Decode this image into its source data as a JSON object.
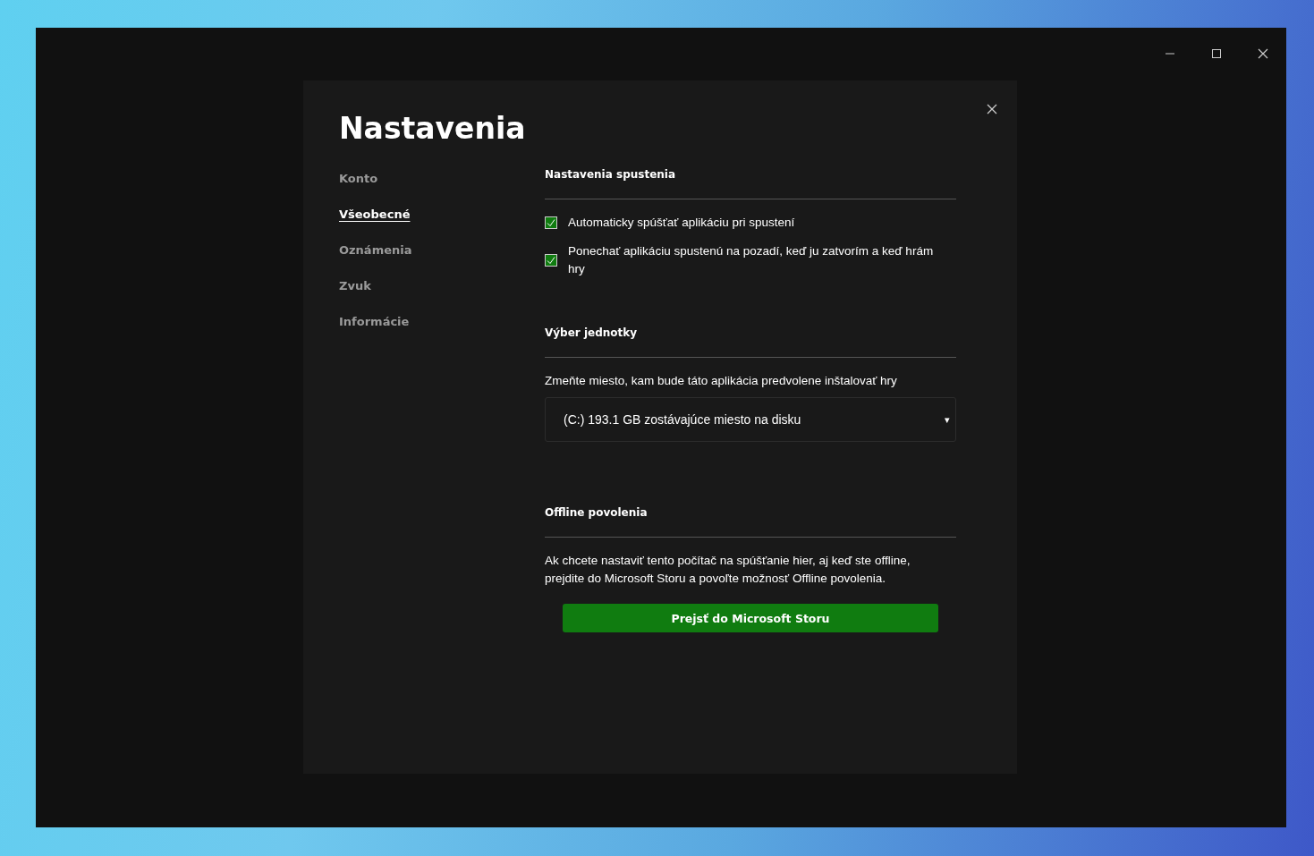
{
  "dialog": {
    "title": "Nastavenia"
  },
  "sidebar": {
    "items": [
      {
        "label": "Konto",
        "selected": false
      },
      {
        "label": "Všeobecné",
        "selected": true
      },
      {
        "label": "Oznámenia",
        "selected": false
      },
      {
        "label": "Zvuk",
        "selected": false
      },
      {
        "label": "Informácie",
        "selected": false
      }
    ]
  },
  "sections": [
    {
      "kind": "checkboxes",
      "heading": "Nastavenia spustenia",
      "options": [
        {
          "label": "Automaticky spúšťať aplikáciu pri spustení",
          "checked": true
        },
        {
          "label": "Ponechať aplikáciu spustenú na pozadí, keď ju zatvorím a keď hrám hry",
          "checked": true
        }
      ]
    },
    {
      "kind": "drive",
      "heading": "Výber jednotky",
      "description": "Zmeňte miesto, kam bude táto aplikácia predvolene inštalovať hry",
      "value": "(C:) 193.1 GB zostávajúce miesto na disku",
      "caret": "▾"
    },
    {
      "kind": "offline",
      "heading": "Offline povolenia",
      "description": "Ak chcete nastaviť tento počítač na spúšťanie hier, aj keď ste offline, prejdite do Microsoft Storu a povoľte možnosť Offline povolenia.",
      "button": "Prejsť do Microsoft Storu"
    }
  ]
}
